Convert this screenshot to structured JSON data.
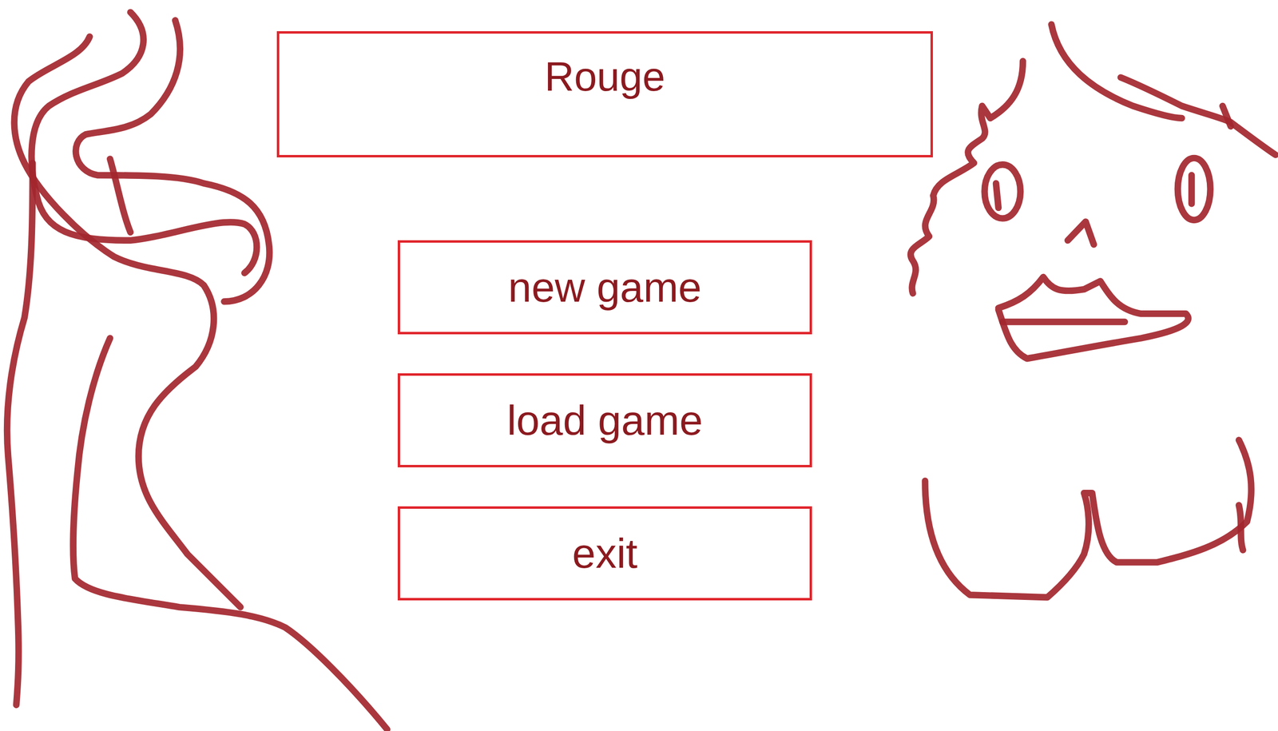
{
  "title": "Rouge",
  "menu": [
    {
      "label": "new game"
    },
    {
      "label": "load game"
    },
    {
      "label": "exit"
    }
  ]
}
